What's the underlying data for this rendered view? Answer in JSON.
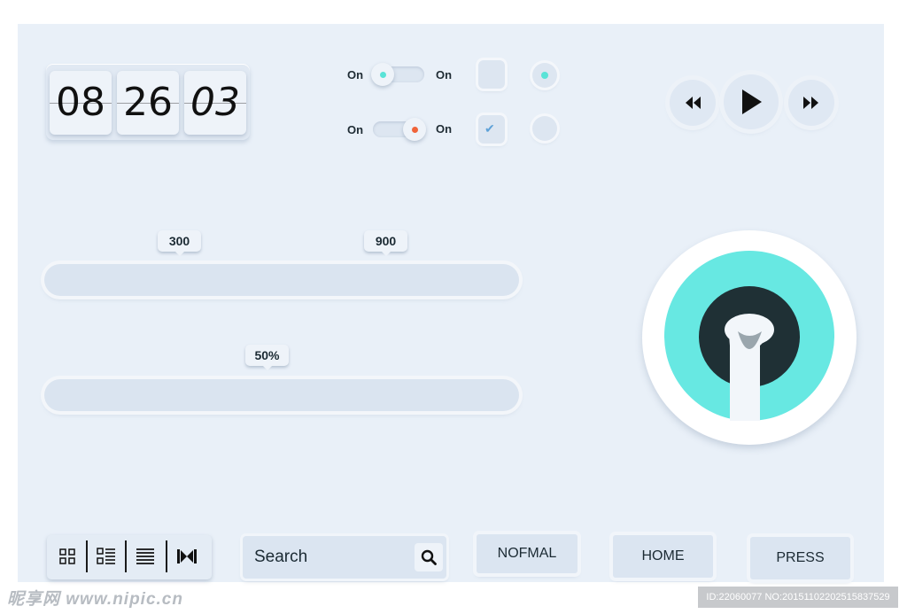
{
  "clock": {
    "hours": "08",
    "minutes": "26",
    "seconds": "03"
  },
  "toggles": [
    {
      "left_label": "On",
      "right_label": "On",
      "state": "left",
      "dot_color": "#59e3d7"
    },
    {
      "left_label": "On",
      "right_label": "On",
      "state": "right",
      "dot_color": "#f0643a"
    }
  ],
  "checkboxes": [
    {
      "checked": false
    },
    {
      "checked": true
    }
  ],
  "radios": [
    {
      "selected": true
    },
    {
      "selected": false
    }
  ],
  "media": {
    "rewind_icon": "rewind-icon",
    "play_icon": "play-icon",
    "forward_icon": "fast-forward-icon"
  },
  "range_slider": {
    "low": "300",
    "high": "900"
  },
  "progress_slider": {
    "value": "50%"
  },
  "dial": {
    "ring_color": "#67e8e2",
    "inner_color": "#1f3035"
  },
  "view_modes": [
    "grid-view-icon",
    "detail-list-icon",
    "list-view-icon",
    "fit-width-icon"
  ],
  "search": {
    "label": "Search",
    "icon": "search-icon"
  },
  "buttons": {
    "normal": "NOFMAL",
    "home": "HOME",
    "press": "PRESS"
  },
  "watermark": {
    "left": "昵享网 www.nipic.cn",
    "right": "ID:22060077 NO:20151102202515837529"
  },
  "colors": {
    "background": "#e9f0f8",
    "accent_teal": "#59e3d7",
    "accent_orange": "#f0643a"
  }
}
